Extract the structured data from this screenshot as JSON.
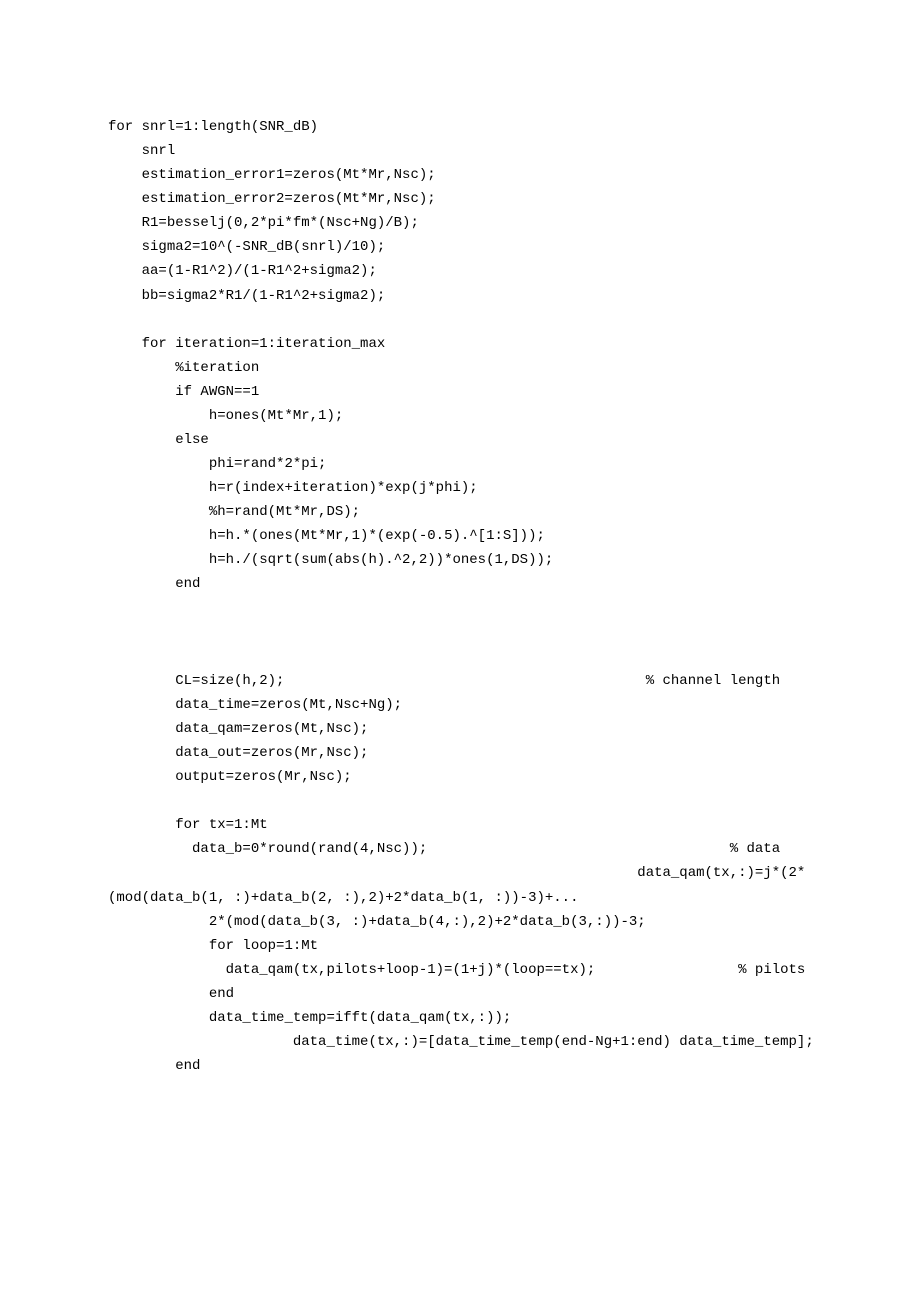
{
  "code": {
    "lines": [
      "for snrl=1:length(SNR_dB)",
      "    snrl",
      "    estimation_error1=zeros(Mt*Mr,Nsc);",
      "    estimation_error2=zeros(Mt*Mr,Nsc);",
      "    R1=besselj(0,2*pi*fm*(Nsc+Ng)/B);",
      "    sigma2=10^(-SNR_dB(snrl)/10);",
      "    aa=(1-R1^2)/(1-R1^2+sigma2);",
      "    bb=sigma2*R1/(1-R1^2+sigma2);",
      "",
      "    for iteration=1:iteration_max",
      "        %iteration",
      "        if AWGN==1",
      "            h=ones(Mt*Mr,1);",
      "        else",
      "            phi=rand*2*pi;",
      "            h=r(index+iteration)*exp(j*phi);",
      "            %h=rand(Mt*Mr,DS);",
      "            h=h.*(ones(Mt*Mr,1)*(exp(-0.5).^[1:S]));",
      "            h=h./(sqrt(sum(abs(h).^2,2))*ones(1,DS));",
      "        end",
      "",
      "",
      "",
      "        CL=size(h,2);                                           % channel length",
      "        data_time=zeros(Mt,Nsc+Ng);",
      "        data_qam=zeros(Mt,Nsc);",
      "        data_out=zeros(Mr,Nsc);",
      "        output=zeros(Mr,Nsc);",
      "",
      "        for tx=1:Mt",
      "          data_b=0*round(rand(4,Nsc));                                    % data",
      "                                                               data_qam(tx,:)=j*(2*(mod(data_b(1, :)+data_b(2, :),2)+2*data_b(1, :))-3)+...",
      "            2*(mod(data_b(3, :)+data_b(4,:),2)+2*data_b(3,:))-3;",
      "            for loop=1:Mt",
      "              data_qam(tx,pilots+loop-1)=(1+j)*(loop==tx);                 % pilots",
      "            end",
      "            data_time_temp=ifft(data_qam(tx,:));",
      "                      data_time(tx,:)=[data_time_temp(end-Ng+1:end) data_time_temp];",
      "        end"
    ]
  }
}
